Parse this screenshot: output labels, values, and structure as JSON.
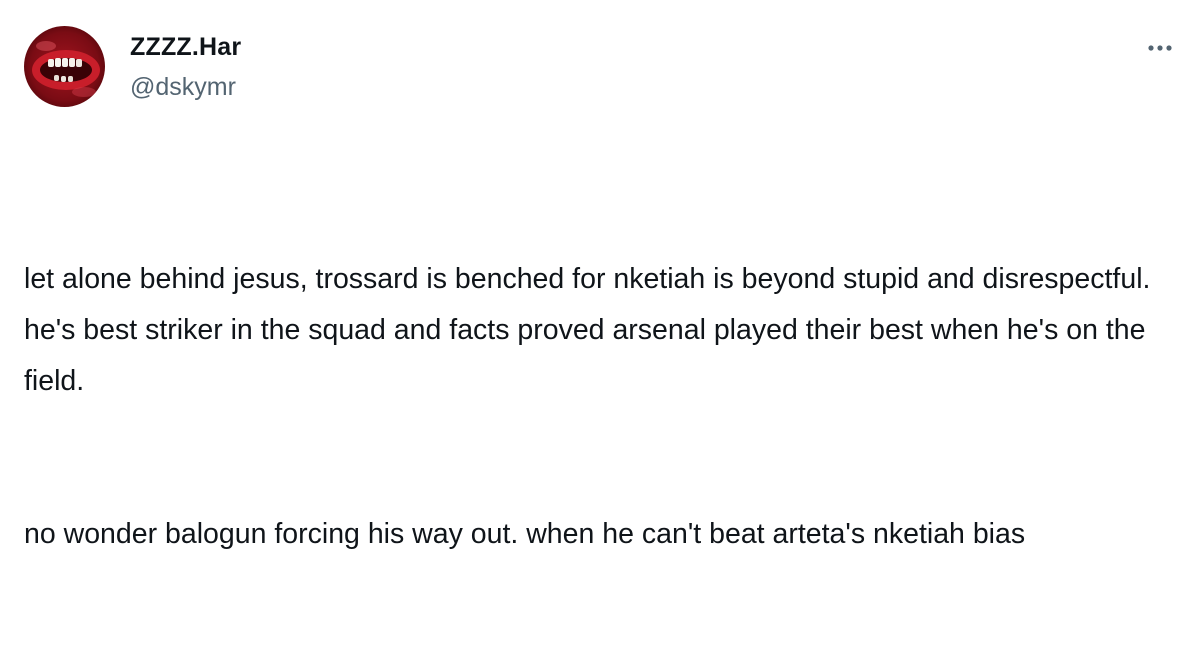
{
  "author": {
    "display_name": "ZZZZ.Har",
    "handle": "@dskymr",
    "avatar_icon": "avatar-red-mouth-image"
  },
  "actions": {
    "more_icon": "more-horizontal-icon"
  },
  "tweet": {
    "paragraph_1": "let alone behind jesus, trossard is benched for nketiah is beyond stupid and disrespectful. he's best striker in the squad and facts proved arsenal played their best when he's on the field.",
    "paragraph_2": "no wonder balogun forcing his way out. when he can't beat arteta's nketiah bias"
  },
  "colors": {
    "text_primary": "#0f1419",
    "text_secondary": "#536471",
    "background": "#ffffff"
  }
}
